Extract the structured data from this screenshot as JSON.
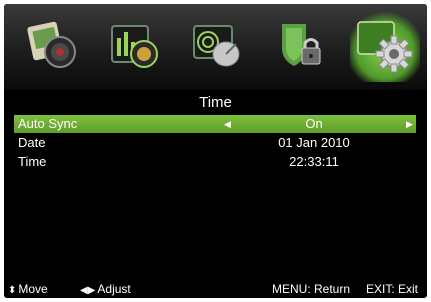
{
  "menu": {
    "tabs": [
      {
        "name": "picture",
        "icon": "camera-picture-icon"
      },
      {
        "name": "sound",
        "icon": "equalizer-sound-icon"
      },
      {
        "name": "channel",
        "icon": "satellite-dish-icon"
      },
      {
        "name": "lock",
        "icon": "shield-lock-icon"
      },
      {
        "name": "setup",
        "icon": "gear-setup-icon",
        "active": true
      }
    ]
  },
  "page": {
    "title": "Time"
  },
  "settings": [
    {
      "label": "Auto Sync",
      "value": "On",
      "selected": true
    },
    {
      "label": "Date",
      "value": "01 Jan 2010"
    },
    {
      "label": "Time",
      "value": "22:33:11"
    }
  ],
  "hints": {
    "move": "Move",
    "adjust": "Adjust",
    "menu": "MENU: Return",
    "exit": "EXIT: Exit"
  },
  "colors": {
    "selected_row": "#6fae34",
    "background": "#000000",
    "text": "#ffffff"
  }
}
